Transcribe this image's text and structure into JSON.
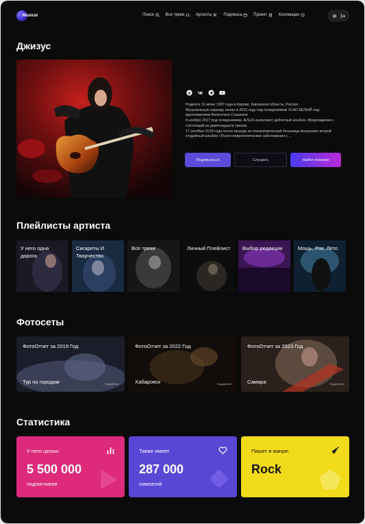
{
  "header": {
    "logo_text": "Musical",
    "nav": [
      {
        "label": "Поиск",
        "icon": "search-icon"
      },
      {
        "label": "Все треки",
        "icon": "headphones-icon"
      },
      {
        "label": "Артисты",
        "icon": "user-music-icon"
      },
      {
        "label": "Подписка",
        "icon": "calendar-icon"
      },
      {
        "label": "Проект",
        "icon": "document-icon"
      },
      {
        "label": "Коллекции",
        "icon": "heart-icon"
      }
    ],
    "actions": [
      "settings-icon",
      "logout-icon"
    ]
  },
  "artist": {
    "name": "Джизус",
    "socials": [
      "spotify-icon",
      "vk-icon",
      "telegram-icon",
      "youtube-icon"
    ],
    "bio": [
      "Родился 12 июня 1997 года в Кирове, Кировская область, Россия.",
      "Музыкальную карьеру начал в 2016 году под псевдонимом VLAD БЕЛЫЙ под вдохновением Валентина Стрыкало",
      "9 ноября 2017 под псевдонимом JESUS выпускает дебютный альбом «Возрождение», состоящий из девятнадцати треков.",
      "17 октября 2018 года после выхода из психиатрической больницы выпускает второй студийный альбом «Психо-неврологические заболевания с ..."
    ],
    "buttons": {
      "subscribe": "Подписаться",
      "listen": "Слушать",
      "similar": "Найти похожих"
    }
  },
  "playlists": {
    "title": "Плейлисты артиста",
    "items": [
      {
        "label": "У него одна дорога"
      },
      {
        "label": "Сигареты И Творчество"
      },
      {
        "label": "Все треки"
      },
      {
        "label": "Личный Плейлист"
      },
      {
        "label": "Выбор редакции"
      },
      {
        "label": "Мощь, Рок, Лето"
      }
    ]
  },
  "photosets": {
    "title": "Фотосеты",
    "items": [
      {
        "title": "ФотоОтчет за 2019 Год",
        "city": "Тур по городам",
        "more": "Подробнее"
      },
      {
        "title": "ФотоОтчет за 2022 Год",
        "city": "Хабаровск",
        "more": "Подробнее"
      },
      {
        "title": "ФотоОтчет за 2023 Год",
        "city": "Самара",
        "more": "Подробнее"
      }
    ]
  },
  "stats": {
    "title": "Статистика",
    "cards": [
      {
        "label": "У него целых:",
        "value": "5 500 000",
        "sub": "подписчиков",
        "icon": "bar-chart-icon",
        "color": "#dd2a7b"
      },
      {
        "label": "Также имеет",
        "value": "287 000",
        "sub": "симпатий",
        "icon": "heart-outline-icon",
        "color": "#5b47d6"
      },
      {
        "label": "Пишет в жанре:",
        "value": "Rock",
        "sub": "",
        "icon": "guitar-icon",
        "color": "#f1db1a"
      }
    ]
  }
}
